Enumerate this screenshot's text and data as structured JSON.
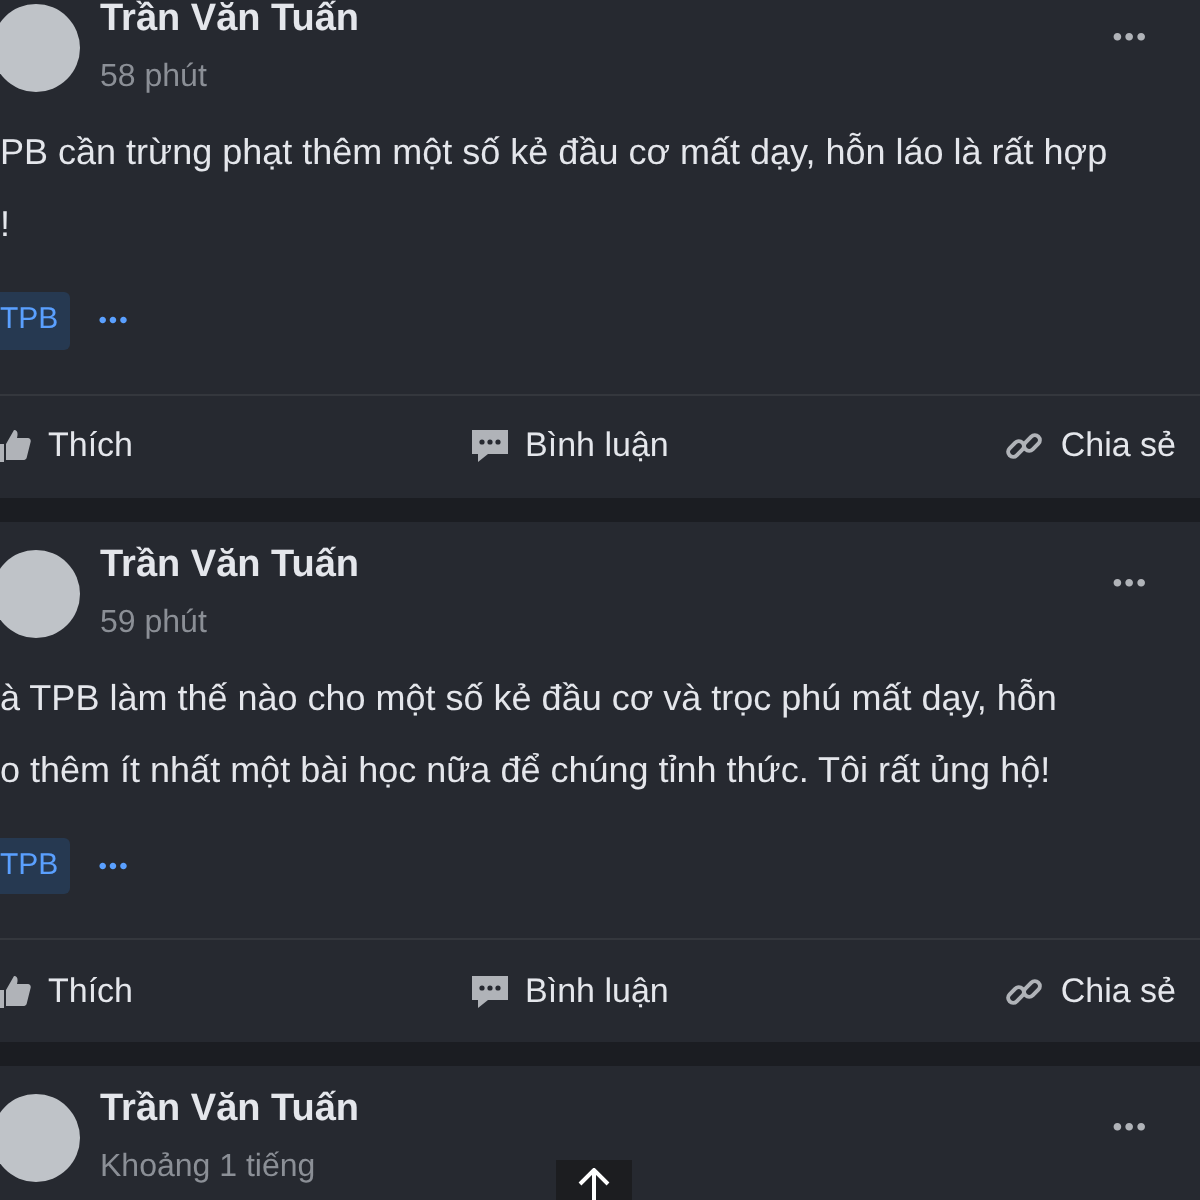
{
  "posts": [
    {
      "author": "Trần Văn Tuấn",
      "time": "58 phút",
      "text": "PB cần trừng phạt thêm một số kẻ đầu cơ mất dạy, hỗn láo là rất hợp\n!",
      "tag": "TPB",
      "more": "•••",
      "actions": [
        "Thích",
        "Bình luận",
        "Chia sẻ"
      ]
    },
    {
      "author": "Trần Văn Tuấn",
      "time": "59 phút",
      "text": "à TPB làm thế nào cho một số kẻ đầu cơ và trọc phú mất dạy, hỗn\no thêm ít nhất một bài học nữa để chúng tỉnh thức. Tôi rất ủng hộ!",
      "tag": "TPB",
      "more": "•••",
      "actions": [
        "Thích",
        "Bình luận",
        "Chia sẻ"
      ]
    },
    {
      "author": "Trần Văn Tuấn",
      "time": "Khoảng 1 tiếng",
      "more": "•••"
    }
  ]
}
